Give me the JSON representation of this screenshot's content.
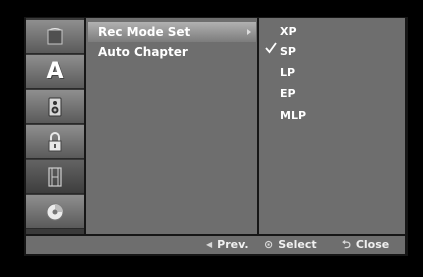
{
  "left_tabs": [
    {
      "icon": "disc-tray-icon",
      "label": ""
    },
    {
      "icon": "language-a-icon",
      "label": "A"
    },
    {
      "icon": "speaker-icon",
      "label": ""
    },
    {
      "icon": "lock-icon",
      "label": ""
    },
    {
      "icon": "film-icon",
      "label": ""
    },
    {
      "icon": "disc-icon",
      "label": ""
    }
  ],
  "menu": {
    "items": [
      {
        "label": "Rec Mode Set"
      },
      {
        "label": "Auto Chapter"
      }
    ]
  },
  "options": {
    "items": [
      {
        "label": "XP"
      },
      {
        "label": "SP"
      },
      {
        "label": "LP"
      },
      {
        "label": "EP"
      },
      {
        "label": "MLP"
      }
    ],
    "checked": "SP"
  },
  "bottom": {
    "prev_icon": "◀",
    "prev": "Prev.",
    "select_icon": "⊙",
    "select": "Select",
    "close_icon": "⮌",
    "close": "Close"
  },
  "colors": {
    "panel": "#6e6e6e",
    "selected_gradient_top": "#b1b1b1",
    "tab_gradient_top": "#8f8f8f"
  }
}
